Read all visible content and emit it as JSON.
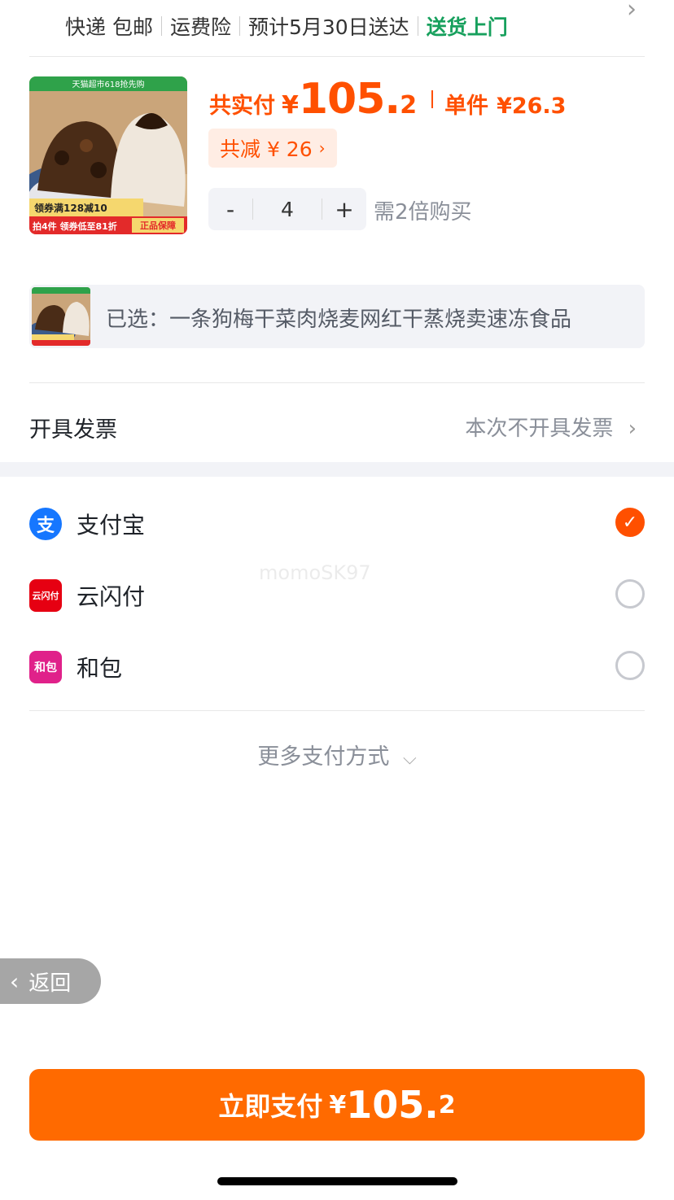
{
  "shipping": {
    "method": "快递 包邮",
    "insurance": "运费险",
    "eta": "预计5月30日送达",
    "delivery": "送货上门"
  },
  "product": {
    "image_banner": "天猫超市618抢先购",
    "image_coupon": "领券满128减10",
    "image_promo": "拍4件 领券低至81折",
    "image_badge": "正品保障",
    "total_label": "共实付",
    "currency": "¥",
    "total_int": "105.",
    "total_dec": "2",
    "unit_label": "单件",
    "unit_price": "¥26.3",
    "discount": "共减 ¥ 26",
    "quantity": "4",
    "minus": "-",
    "plus": "+",
    "quantity_note": "需2倍购买"
  },
  "selected": {
    "text": "已选：一条狗梅干菜肉烧麦网红干蒸烧卖速冻食品"
  },
  "invoice": {
    "label": "开具发票",
    "value": "本次不开具发票"
  },
  "payment_methods": [
    {
      "name": "支付宝",
      "icon": "alipay-icon",
      "icon_text": "支",
      "color": "#1677ff",
      "selected": true
    },
    {
      "name": "云闪付",
      "icon": "unionpay-icon",
      "icon_text": "云闪付",
      "color": "#e60012",
      "selected": false
    },
    {
      "name": "和包",
      "icon": "hebao-icon",
      "icon_text": "和包",
      "color": "#e0218a",
      "selected": false
    }
  ],
  "more_payments": "更多支付方式",
  "watermark": "momoSK97",
  "back_label": "返回",
  "pay_button": {
    "label": "立即支付",
    "currency": "¥",
    "amount_int": "105.",
    "amount_dec": "2"
  },
  "colors": {
    "accent": "#ff5000",
    "button": "#ff6a00",
    "green": "#17a05d"
  }
}
